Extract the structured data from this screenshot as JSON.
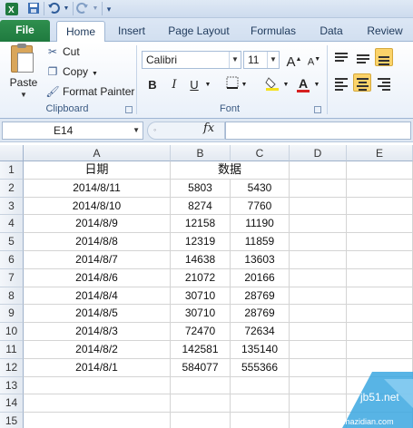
{
  "quick_access": {
    "save_icon": "save-icon",
    "undo_icon": "undo-icon",
    "redo_icon": "redo-icon"
  },
  "tabs": [
    {
      "label": "File"
    },
    {
      "label": "Home"
    },
    {
      "label": "Insert"
    },
    {
      "label": "Page Layout"
    },
    {
      "label": "Formulas"
    },
    {
      "label": "Data"
    },
    {
      "label": "Review"
    }
  ],
  "clipboard": {
    "paste_label": "Paste",
    "cut_label": "Cut",
    "copy_label": "Copy",
    "format_painter_label": "Format Painter",
    "group_label": "Clipboard"
  },
  "font": {
    "name": "Calibri",
    "size": "11",
    "bold": "B",
    "italic": "I",
    "underline": "U",
    "grow": "A",
    "shrink": "A",
    "font_color_glyph": "A",
    "group_label": "Font",
    "font_color": "#d62020",
    "fill_color": "#f5e11a"
  },
  "formula_bar": {
    "name_box": "E14",
    "fx_label": "fx",
    "content": ""
  },
  "sheet": {
    "columns": [
      "A",
      "B",
      "C",
      "D",
      "E"
    ],
    "rows": [
      "1",
      "2",
      "3",
      "4",
      "5",
      "6",
      "7",
      "8",
      "9",
      "10",
      "11",
      "12",
      "13",
      "14",
      "15"
    ],
    "header": {
      "a": "日期",
      "b": "数据"
    },
    "data": [
      {
        "date": "2014/8/11",
        "b": "5803",
        "c": "5430"
      },
      {
        "date": "2014/8/10",
        "b": "8274",
        "c": "7760"
      },
      {
        "date": "2014/8/9",
        "b": "12158",
        "c": "11190"
      },
      {
        "date": "2014/8/8",
        "b": "12319",
        "c": "11859"
      },
      {
        "date": "2014/8/7",
        "b": "14638",
        "c": "13603"
      },
      {
        "date": "2014/8/6",
        "b": "21072",
        "c": "20166"
      },
      {
        "date": "2014/8/4",
        "b": "30710",
        "c": "28769"
      },
      {
        "date": "2014/8/5",
        "b": "30710",
        "c": "28769"
      },
      {
        "date": "2014/8/3",
        "b": "72470",
        "c": "72634"
      },
      {
        "date": "2014/8/2",
        "b": "142581",
        "c": "135140"
      },
      {
        "date": "2014/8/1",
        "b": "584077",
        "c": "555366"
      }
    ]
  },
  "watermark": {
    "text": "jb51.net",
    "sub": "jiaocheng.chazidian.com"
  }
}
